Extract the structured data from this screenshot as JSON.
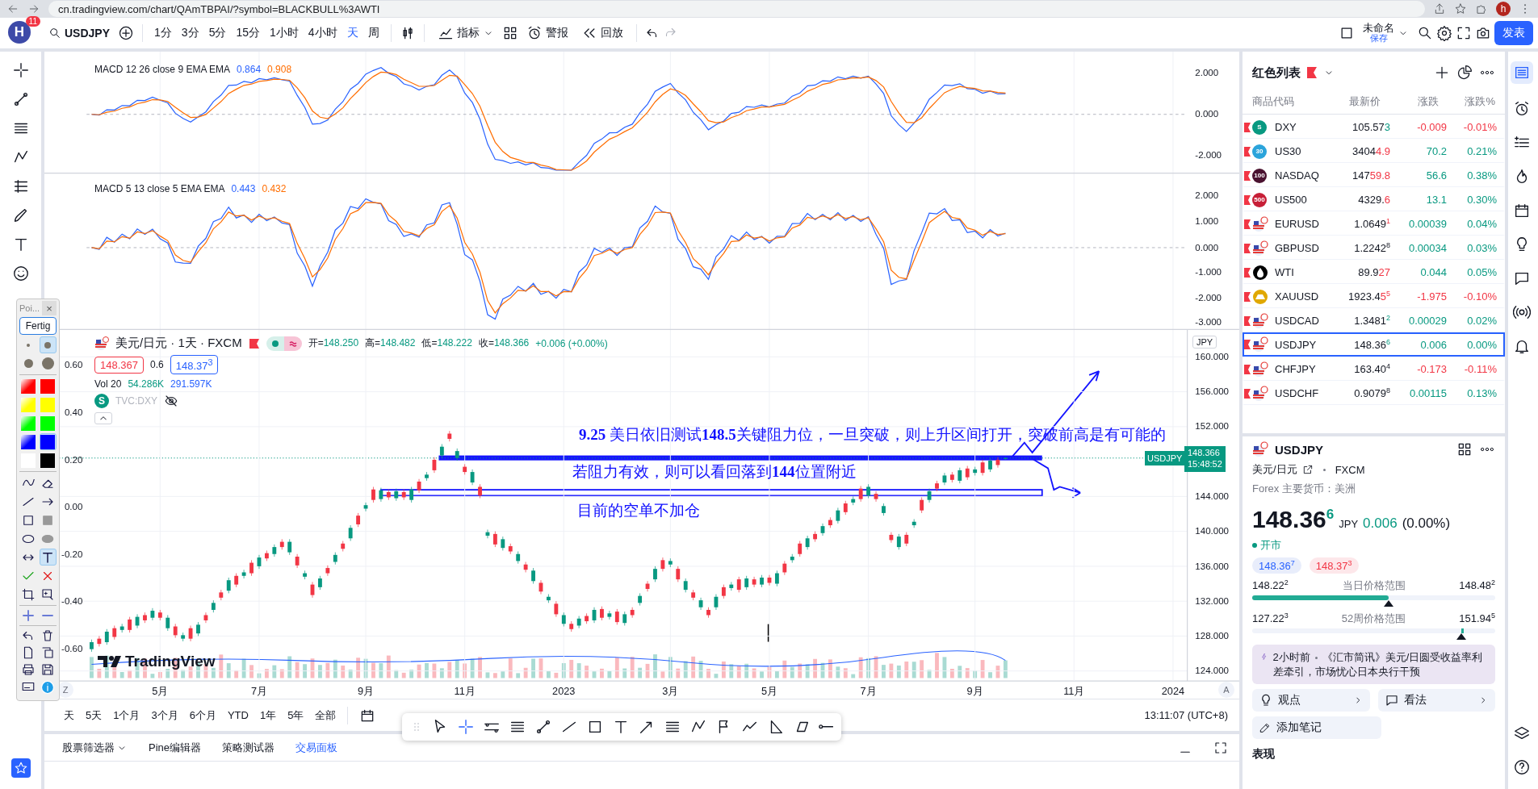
{
  "browser": {
    "url": "cn.tradingview.com/chart/QAmTBPAI/?symbol=BLACKBULL%3AWTI",
    "profile": "h"
  },
  "header": {
    "avatar": "H",
    "notifications": "11",
    "symbol": "USDJPY",
    "intervals": [
      {
        "label": "1分",
        "selected": false
      },
      {
        "label": "3分",
        "selected": false
      },
      {
        "label": "5分",
        "selected": false
      },
      {
        "label": "15分",
        "selected": false
      },
      {
        "label": "1小时",
        "selected": false
      },
      {
        "label": "4小时",
        "selected": false
      },
      {
        "label": "天",
        "selected": true
      },
      {
        "label": "周",
        "selected": false
      }
    ],
    "indicators": "指标",
    "alert": "警报",
    "replay": "回放",
    "layout_name": "未命名",
    "layout_status": "保存",
    "publish": "发表"
  },
  "paint_panel": {
    "title": "Poi...",
    "close": "×",
    "done": "Fertig",
    "brush_sizes": [
      {
        "selected": false
      },
      {
        "selected": true
      },
      {
        "selected": false
      },
      {
        "selected": false
      }
    ],
    "colors": [
      {
        "kind": "gradient",
        "color": "#ff0000",
        "selected": false
      },
      {
        "kind": "solid",
        "color": "#ff0000",
        "selected": false
      },
      {
        "kind": "gradient",
        "color": "#ffff00",
        "selected": false
      },
      {
        "kind": "solid",
        "color": "#ffff00",
        "selected": false
      },
      {
        "kind": "gradient",
        "color": "#00ff00",
        "selected": false
      },
      {
        "kind": "solid",
        "color": "#00ff00",
        "selected": false
      },
      {
        "kind": "gradient",
        "color": "#0000ff",
        "selected": false
      },
      {
        "kind": "solid",
        "color": "#0000ff",
        "selected": true
      },
      {
        "kind": "solid",
        "color": "#ffffff",
        "selected": false
      },
      {
        "kind": "solid",
        "color": "#000000",
        "selected": false
      }
    ],
    "tools": [
      {
        "kind": "freehand",
        "selected": false
      },
      {
        "kind": "eraser",
        "selected": false
      },
      {
        "kind": "line",
        "selected": false
      },
      {
        "kind": "arrow",
        "selected": false
      },
      {
        "kind": "rect",
        "selected": false
      },
      {
        "kind": "filled-rect",
        "selected": false
      },
      {
        "kind": "ellipse",
        "selected": false
      },
      {
        "kind": "filled-ellipse",
        "selected": false
      },
      {
        "kind": "double-arrow",
        "selected": false
      },
      {
        "kind": "text",
        "selected": true
      },
      {
        "kind": "accept",
        "selected": false
      },
      {
        "kind": "reject",
        "selected": false
      },
      {
        "kind": "crop",
        "selected": false
      },
      {
        "kind": "zoom-box",
        "selected": false
      }
    ]
  },
  "chart": {
    "macd_panes": [
      {
        "label": "MACD 12 26 close 9 EMA EMA",
        "macd": "0.864",
        "signal": "0.908",
        "axis": [
          "2.000",
          "0.000",
          "-2.000"
        ]
      },
      {
        "label": "MACD 5 13 close 5 EMA EMA",
        "macd": "0.443",
        "signal": "0.432",
        "axis": [
          "2.000",
          "1.000",
          "0.000",
          "-1.000",
          "-2.000",
          "-3.000"
        ]
      }
    ],
    "title": "美元/日元 · 1天 · FXCM",
    "ohlc": [
      {
        "label": "开=",
        "value": "148.250"
      },
      {
        "label": "高=",
        "value": "148.482"
      },
      {
        "label": "低=",
        "value": "148.222"
      },
      {
        "label": "收=",
        "value": "148.366"
      }
    ],
    "change": "+0.006 (+0.00%)",
    "sell": "148.367",
    "spread": "0.6",
    "buy": "148.37$^{3}$",
    "volume": {
      "label": "Vol 20",
      "value": "54.286K",
      "average": "291.597K"
    },
    "compare_logo": "S",
    "compare": "TVC:DXY",
    "currency": "JPY",
    "left_axis": [
      "0.60",
      "0.40",
      "0.20",
      "0.00",
      "-0.20",
      "-0.40",
      "-0.60"
    ],
    "last_price": {
      "symbol": "USDJPY",
      "price": "148.366",
      "countdown": "15:48:52"
    },
    "chart_data": {
      "type": "candlestick",
      "grid": true,
      "ylim": [
        122.85,
        163.08
      ],
      "categories": [
        null,
        null,
        null,
        null,
        null,
        null,
        null,
        null,
        null,
        "5月",
        null,
        null,
        null,
        null,
        null,
        null,
        null,
        null,
        null,
        null,
        null,
        null,
        "7月",
        null,
        null,
        null,
        null,
        null,
        null,
        null,
        null,
        null,
        null,
        null,
        null,
        null,
        "9月",
        null,
        null,
        null,
        null,
        null,
        null,
        null,
        null,
        null,
        null,
        null,
        null,
        "11月",
        null,
        null,
        null,
        null,
        null,
        null,
        null,
        null,
        null,
        null,
        null,
        null,
        "2023",
        null,
        null,
        null,
        null,
        null,
        null,
        null,
        null,
        null,
        null,
        null,
        null,
        null,
        "3月",
        null,
        null,
        null,
        null,
        null,
        null,
        null,
        null,
        null,
        null,
        null,
        null,
        "5月",
        null,
        null,
        null,
        null,
        null,
        null,
        null,
        null,
        null,
        null,
        null,
        null,
        "7月",
        null,
        null,
        null,
        null,
        null,
        null,
        null,
        null,
        null,
        null,
        null,
        null,
        null,
        "9月",
        null,
        null,
        null,
        null,
        null,
        null,
        null,
        null,
        null,
        null,
        null,
        null,
        "11月",
        null,
        null,
        null,
        null,
        null,
        null,
        null,
        null,
        null,
        null,
        null,
        null,
        "2024",
        null,
        null
      ],
      "ohlc": [
        [
          126.5,
          127.6,
          126.2,
          127.3
        ],
        [
          127.7,
          128.0,
          126.8,
          127.1
        ],
        [
          127.3,
          128.8,
          127.0,
          128.5
        ],
        [
          128.9,
          129.2,
          127.6,
          127.9
        ],
        [
          128.7,
          129.4,
          128.4,
          129.1
        ],
        [
          129.9,
          130.2,
          128.4,
          128.7
        ],
        [
          129.2,
          130.5,
          128.9,
          130.2
        ],
        [
          130.4,
          130.7,
          129.5,
          129.8
        ],
        [
          130.1,
          131.2,
          129.8,
          130.9
        ],
        [
          130.7,
          131.0,
          129.8,
          130.1
        ],
        [
          128.9,
          130.4,
          128.6,
          130.1
        ],
        [
          129.1,
          129.4,
          127.8,
          128.1
        ],
        [
          127.7,
          128.4,
          127.4,
          128.1
        ],
        [
          128.9,
          129.2,
          127.4,
          127.7
        ],
        [
          128.3,
          129.6,
          128.0,
          129.3
        ],
        [
          130.4,
          130.7,
          129.5,
          129.8
        ],
        [
          131.0,
          132.1,
          130.7,
          131.8
        ],
        [
          133.0,
          133.3,
          132.1,
          132.4
        ],
        [
          133.2,
          134.7,
          132.9,
          134.4
        ],
        [
          134.9,
          135.2,
          133.6,
          133.9
        ],
        [
          134.9,
          135.6,
          134.6,
          135.3
        ],
        [
          136.4,
          136.7,
          134.9,
          135.2
        ],
        [
          136.0,
          137.3,
          135.7,
          137.0
        ],
        [
          137.5,
          137.8,
          136.6,
          136.9
        ],
        [
          137.4,
          138.5,
          137.1,
          138.2
        ],
        [
          138.8,
          139.1,
          137.9,
          138.2
        ],
        [
          137.6,
          139.1,
          137.3,
          138.8
        ],
        [
          137.1,
          137.4,
          135.8,
          136.1
        ],
        [
          134.8,
          135.5,
          134.5,
          135.2
        ],
        [
          133.9,
          134.2,
          132.4,
          132.7
        ],
        [
          133.6,
          134.9,
          133.3,
          134.6
        ],
        [
          135.8,
          136.1,
          134.9,
          135.2
        ],
        [
          136.5,
          137.6,
          136.2,
          137.3
        ],
        [
          138.6,
          138.9,
          137.7,
          138.0
        ],
        [
          139.2,
          140.7,
          138.9,
          140.4
        ],
        [
          141.8,
          142.1,
          140.5,
          140.8
        ],
        [
          142.6,
          143.3,
          142.3,
          143.0
        ],
        [
          144.8,
          145.1,
          143.3,
          143.6
        ],
        [
          143.7,
          145.0,
          143.4,
          144.7
        ],
        [
          144.5,
          144.8,
          143.6,
          143.9
        ],
        [
          143.8,
          144.9,
          143.5,
          144.6
        ],
        [
          144.5,
          144.8,
          143.6,
          143.9
        ],
        [
          143.6,
          145.1,
          143.3,
          144.8
        ],
        [
          145.7,
          146.0,
          144.4,
          144.7
        ],
        [
          146.1,
          146.8,
          145.8,
          146.5
        ],
        [
          148.2,
          148.5,
          146.7,
          147.0
        ],
        [
          148.7,
          150.0,
          148.4,
          149.7
        ],
        [
          151.2,
          151.5,
          150.3,
          150.6
        ],
        [
          148.4,
          149.5,
          148.1,
          149.2
        ],
        [
          147.4,
          147.7,
          146.5,
          146.8
        ],
        [
          145.6,
          147.1,
          145.3,
          146.8
        ],
        [
          145.1,
          145.4,
          143.8,
          144.1
        ],
        [
          139.5,
          140.2,
          139.2,
          139.9
        ],
        [
          139.7,
          140.0,
          138.2,
          138.5
        ],
        [
          138.1,
          139.4,
          137.8,
          139.1
        ],
        [
          138.3,
          138.6,
          137.4,
          137.7
        ],
        [
          136.6,
          137.7,
          136.3,
          137.4
        ],
        [
          136.2,
          136.5,
          135.3,
          135.6
        ],
        [
          134.3,
          135.8,
          134.0,
          135.5
        ],
        [
          134.1,
          134.4,
          132.8,
          133.1
        ],
        [
          132.1,
          132.8,
          131.8,
          132.5
        ],
        [
          131.7,
          132.0,
          130.2,
          130.5
        ],
        [
          129.4,
          130.7,
          129.1,
          130.4
        ],
        [
          129.4,
          129.7,
          128.5,
          128.8
        ],
        [
          129.2,
          130.3,
          128.9,
          130.0
        ],
        [
          130.3,
          130.6,
          129.4,
          129.7
        ],
        [
          129.8,
          131.3,
          129.5,
          131.0
        ],
        [
          131.1,
          131.4,
          129.8,
          130.1
        ],
        [
          130.2,
          130.9,
          129.9,
          130.6
        ],
        [
          130.8,
          131.1,
          129.3,
          129.6
        ],
        [
          129.5,
          130.8,
          129.2,
          130.5
        ],
        [
          131.0,
          131.3,
          130.1,
          130.4
        ],
        [
          131.8,
          132.9,
          131.5,
          132.6
        ],
        [
          134.0,
          134.3,
          133.1,
          133.4
        ],
        [
          134.5,
          136.0,
          134.2,
          135.7
        ],
        [
          136.7,
          137.0,
          135.4,
          135.7
        ],
        [
          136.2,
          136.9,
          135.9,
          136.6
        ],
        [
          135.7,
          136.0,
          134.2,
          134.5
        ],
        [
          133.3,
          134.6,
          133.0,
          134.3
        ],
        [
          133.0,
          133.3,
          132.1,
          132.4
        ],
        [
          131.3,
          132.4,
          131.0,
          132.1
        ],
        [
          131.0,
          131.3,
          130.1,
          130.4
        ],
        [
          131.3,
          132.8,
          131.0,
          132.5
        ],
        [
          133.6,
          133.9,
          132.3,
          132.6
        ],
        [
          133.5,
          134.2,
          133.2,
          133.9
        ],
        [
          134.5,
          134.8,
          133.0,
          133.3
        ],
        [
          133.6,
          134.9,
          133.3,
          134.6
        ],
        [
          134.5,
          134.8,
          133.6,
          133.9
        ],
        [
          133.9,
          135.0,
          133.6,
          134.7
        ],
        [
          134.7,
          135.0,
          133.8,
          134.1
        ],
        [
          134.0,
          135.5,
          133.7,
          135.2
        ],
        [
          136.3,
          136.6,
          135.0,
          135.3
        ],
        [
          136.7,
          137.4,
          136.4,
          137.1
        ],
        [
          138.6,
          138.9,
          137.1,
          137.4
        ],
        [
          138.2,
          139.5,
          137.9,
          139.2
        ],
        [
          139.7,
          140.0,
          138.8,
          139.1
        ],
        [
          139.8,
          140.9,
          139.5,
          140.6
        ],
        [
          141.3,
          141.6,
          140.4,
          140.7
        ],
        [
          141.2,
          142.7,
          140.9,
          142.4
        ],
        [
          143.2,
          143.5,
          141.9,
          142.2
        ],
        [
          143.3,
          144.0,
          143.0,
          143.7
        ],
        [
          144.9,
          145.2,
          143.4,
          143.7
        ],
        [
          144.1,
          145.4,
          143.8,
          145.1
        ],
        [
          144.3,
          144.6,
          143.4,
          143.7
        ],
        [
          142.1,
          143.2,
          141.8,
          142.9
        ],
        [
          139.6,
          139.9,
          138.7,
          139.0
        ],
        [
          138.2,
          139.7,
          137.9,
          139.4
        ],
        [
          139.6,
          139.9,
          138.3,
          138.6
        ],
        [
          140.7,
          141.4,
          140.4,
          141.1
        ],
        [
          143.6,
          143.9,
          142.1,
          142.4
        ],
        [
          143.6,
          144.9,
          143.3,
          144.6
        ],
        [
          145.5,
          145.8,
          144.6,
          144.9
        ],
        [
          145.6,
          146.7,
          145.3,
          146.4
        ],
        [
          146.5,
          146.8,
          145.6,
          145.9
        ],
        [
          145.8,
          147.3,
          145.5,
          147.0
        ],
        [
          147.2,
          147.5,
          145.9,
          146.2
        ],
        [
          146.7,
          147.4,
          146.4,
          147.1
        ],
        [
          147.9,
          148.2,
          146.4,
          146.7
        ],
        [
          147.1,
          148.4,
          146.8,
          148.1
        ],
        [
          148.2,
          148.5,
          147.3,
          147.6
        ],
        [
          148.3,
          148.5,
          148.2,
          148.4
        ],
        null,
        null,
        null,
        null,
        null,
        null,
        null,
        null,
        null,
        null,
        null,
        null,
        null,
        null,
        null,
        null,
        null,
        null,
        null,
        null,
        null,
        null,
        null,
        null
      ],
      "yticks": [
        {
          "value": 160,
          "label": "160.000"
        },
        {
          "value": 156,
          "label": "156.000"
        },
        {
          "value": 152,
          "label": "152.000"
        },
        {
          "value": 144,
          "label": "144.000"
        },
        {
          "value": 140,
          "label": "140.000"
        },
        {
          "value": 136,
          "label": "136.000"
        },
        {
          "value": 132,
          "label": "132.000"
        },
        {
          "value": 128,
          "label": "128.000"
        },
        {
          "value": 124,
          "label": "124.000"
        }
      ]
    },
    "axis_buttons": [
      "Z",
      "A"
    ],
    "annotations": [
      "**9.25** 美日依旧测试**148.5**关键阻力位，一旦突破，则上升区间打开，突破前高是有可能的",
      "若阻力有效，则可以看回落到**144**位置附近",
      "目前的空单不加仓"
    ],
    "logo": "TradingView"
  },
  "range_bar": {
    "ranges": [
      "天",
      "5天",
      "1个月",
      "3个月",
      "6个月",
      "YTD",
      "1年",
      "5年",
      "全部"
    ],
    "time": "13:11:07 (UTC+8)"
  },
  "drawing_bar": [
    {
      "kind": "cursor",
      "selected": false
    },
    {
      "kind": "crosshair",
      "selected": true
    },
    {
      "kind": "channel",
      "selected": false
    },
    {
      "kind": "fib",
      "selected": false
    },
    {
      "kind": "trend-angle",
      "selected": false
    },
    {
      "kind": "line",
      "selected": false
    },
    {
      "kind": "rect",
      "selected": false
    },
    {
      "kind": "text",
      "selected": false
    },
    {
      "kind": "arrow",
      "selected": false
    },
    {
      "kind": "lines",
      "selected": false
    },
    {
      "kind": "pattern",
      "selected": false
    },
    {
      "kind": "flag",
      "selected": false
    },
    {
      "kind": "path",
      "selected": false
    },
    {
      "kind": "triangle",
      "selected": false
    },
    {
      "kind": "parallelogram",
      "selected": false
    },
    {
      "kind": "ray",
      "selected": false
    }
  ],
  "bottom_tabs": [
    {
      "label": "股票筛选器",
      "selected": false
    },
    {
      "label": "Pine编辑器",
      "selected": false
    },
    {
      "label": "策略测试器",
      "selected": false
    },
    {
      "label": "交易面板",
      "selected": true
    }
  ],
  "watchlist": {
    "title": "红色列表",
    "columns": [
      "商品代码",
      "最新价",
      "涨跌",
      "涨跌%"
    ],
    "rows": [
      {
        "kind": "text",
        "logo": "S",
        "color": "#089981",
        "symbol": "DXY",
        "price": "105.57",
        "tail": "3",
        "tail_rising": true,
        "change": "-0.009",
        "percent": "-0.01%",
        "rising": false,
        "selected": false
      },
      {
        "kind": "text",
        "logo": "30",
        "color": "#2ba4db",
        "symbol": "US30",
        "price": "3404",
        "tail": "4.9",
        "tail_rising": false,
        "change": "70.2",
        "percent": "0.21%",
        "rising": true,
        "selected": false
      },
      {
        "kind": "text",
        "logo": "100",
        "color": "#4a1230",
        "symbol": "NASDAQ",
        "price": "147",
        "tail": "59.8",
        "tail_rising": false,
        "change": "56.6",
        "percent": "0.38%",
        "rising": true,
        "selected": false
      },
      {
        "kind": "text",
        "logo": "500",
        "color": "#c71f37",
        "symbol": "US500",
        "price": "4329.",
        "tail": "6",
        "tail_rising": false,
        "change": "13.1",
        "percent": "0.30%",
        "rising": true,
        "selected": false
      },
      {
        "kind": "flags",
        "symbol": "EURUSD",
        "price": "1.0649",
        "sup": "1",
        "tail_rising": false,
        "change": "0.00039",
        "percent": "0.04%",
        "rising": true,
        "selected": false
      },
      {
        "kind": "flags",
        "symbol": "GBPUSD",
        "price": "1.2242",
        "sup": "8",
        "change": "0.00034",
        "percent": "0.03%",
        "rising": true,
        "selected": false
      },
      {
        "kind": "drop",
        "color": "#000000",
        "symbol": "WTI",
        "price": "89.9",
        "tail": "27",
        "tail_rising": false,
        "change": "0.044",
        "percent": "0.05%",
        "rising": true,
        "selected": false
      },
      {
        "kind": "bar",
        "color": "#e0a800",
        "symbol": "XAUUSD",
        "price": "1923.4",
        "tail": "5",
        "sup": "5",
        "tail_rising": false,
        "change": "-1.975",
        "percent": "-0.10%",
        "rising": false,
        "selected": false
      },
      {
        "kind": "flags",
        "symbol": "USDCAD",
        "price": "1.3481",
        "sup": "2",
        "tail_rising": true,
        "change": "0.00029",
        "percent": "0.02%",
        "rising": true,
        "selected": false
      },
      {
        "kind": "flags",
        "symbol": "USDJPY",
        "price": "148.36",
        "sup": "6",
        "tail_rising": true,
        "change": "0.006",
        "percent": "0.00%",
        "rising": true,
        "selected": true
      },
      {
        "kind": "flags",
        "symbol": "CHFJPY",
        "price": "163.40",
        "sup": "4",
        "change": "-0.173",
        "percent": "-0.11%",
        "rising": false,
        "selected": false
      },
      {
        "kind": "flags",
        "symbol": "USDCHF",
        "price": "0.9079",
        "sup": "8",
        "change": "0.00115",
        "percent": "0.13%",
        "rising": true,
        "selected": false
      }
    ]
  },
  "details": {
    "symbol": "USDJPY",
    "name": "美元/日元",
    "exchange": "FXCM",
    "category": "Forex 主要货币：美洲",
    "price": "148.36",
    "price_sup": "6",
    "currency": "JPY",
    "change": "0.006",
    "change_percent": "(0.00%)",
    "status": "开市",
    "bid": "148.36$^{7}$",
    "ask": "148.37$^{3}$",
    "ranges": [
      {
        "kind": "day",
        "low": "148.22$^{2}$",
        "label": "当日价格范围",
        "high": "148.48$^{2}$",
        "level": 0.56
      },
      {
        "kind": "week52",
        "low": "127.22$^{3}$",
        "label": "52周价格范围",
        "high": "151.94$^{5}$",
        "level": 0.86
      }
    ],
    "news": {
      "time": "2小时前",
      "text": "《汇市简讯》美元/日圆受收益率利差牵引，市场忧心日本央行干预"
    },
    "buttons": [
      "观点",
      "看法"
    ],
    "add_note": "添加笔记",
    "section": "表现"
  }
}
